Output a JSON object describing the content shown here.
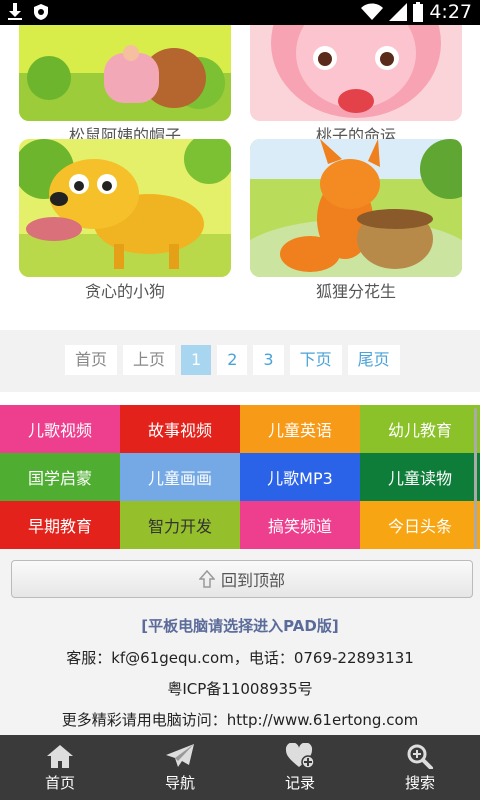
{
  "status_bar": {
    "time": "4:27",
    "icons": [
      "download-icon",
      "shield-icon",
      "wifi-icon",
      "signal-icon",
      "battery-icon"
    ]
  },
  "cards": [
    {
      "title": "松鼠阿姨的帽子",
      "image": "squirrel-illustration"
    },
    {
      "title": "桃子的命运",
      "image": "peach-illustration"
    },
    {
      "title": "贪心的小狗",
      "image": "dog-illustration"
    },
    {
      "title": "狐狸分花生",
      "image": "fox-illustration"
    }
  ],
  "pagination": {
    "first": "首页",
    "prev": "上页",
    "pages": [
      "1",
      "2",
      "3"
    ],
    "current": "1",
    "next": "下页",
    "last": "尾页"
  },
  "categories": [
    {
      "label": "儿歌视频",
      "color": "#ee3f8f"
    },
    {
      "label": "故事视频",
      "color": "#e2221b"
    },
    {
      "label": "儿童英语",
      "color": "#f79a17"
    },
    {
      "label": "幼儿教育",
      "color": "#8bc22a"
    },
    {
      "label": "国学启蒙",
      "color": "#4fae32"
    },
    {
      "label": "儿童画画",
      "color": "#74a9e6"
    },
    {
      "label": "儿歌MP3",
      "color": "#2a62e8"
    },
    {
      "label": "儿童读物",
      "color": "#0f7d3a"
    },
    {
      "label": "早期教育",
      "color": "#e2221b"
    },
    {
      "label": "智力开发",
      "color": "#95c02b"
    },
    {
      "label": "搞笑频道",
      "color": "#ee3f8f"
    },
    {
      "label": "今日头条",
      "color": "#f7a512"
    }
  ],
  "footer": {
    "back_to_top": "回到顶部",
    "pad_link": "[平板电脑请选择进入PAD版]",
    "contact": "客服：kf@61gequ.com，电话：0769-22893131",
    "icp": "粤ICP备11008935号",
    "desktop": "更多精彩请用电脑访问：http://www.61ertong.com"
  },
  "tab_bar": [
    {
      "label": "首页",
      "icon": "home-icon"
    },
    {
      "label": "导航",
      "icon": "paper-plane-icon"
    },
    {
      "label": "记录",
      "icon": "heart-plus-icon"
    },
    {
      "label": "搜索",
      "icon": "search-icon"
    }
  ]
}
